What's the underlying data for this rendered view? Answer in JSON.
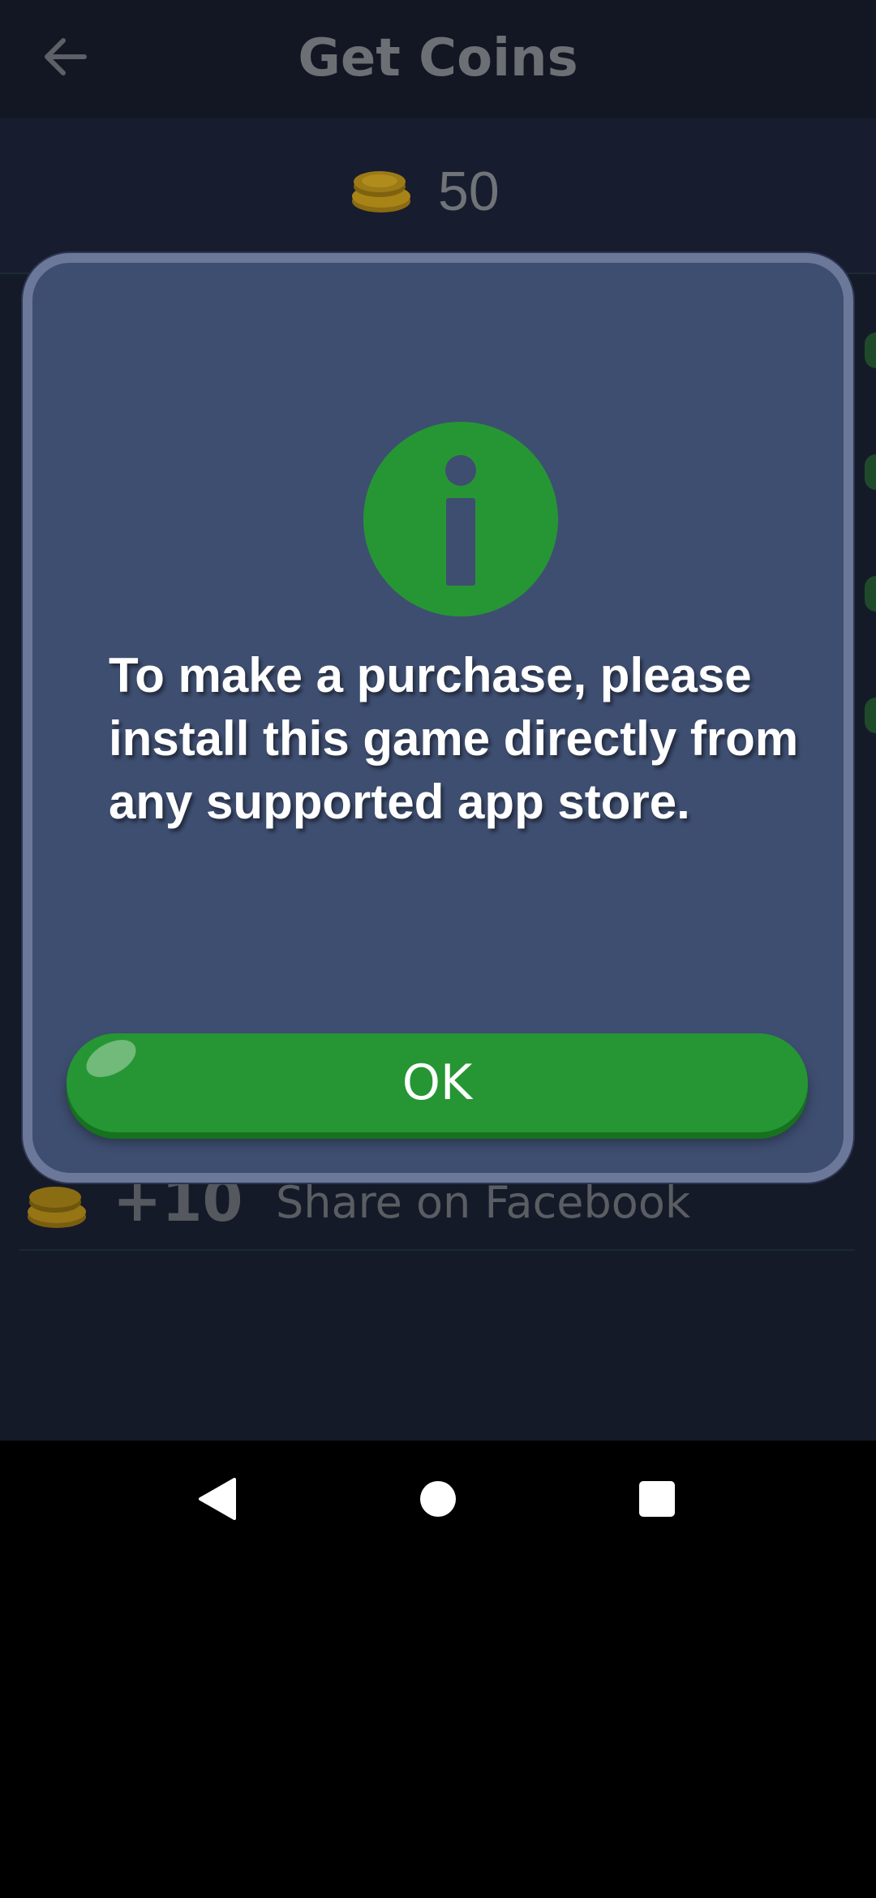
{
  "header": {
    "title": "Get Coins",
    "back_icon": "arrow-left-icon"
  },
  "balance": {
    "coin_icon": "coin-stack-icon",
    "value": "50"
  },
  "rewards": [
    {
      "coin_icon": "coin-stack-icon",
      "amount": "+10",
      "label": "Share on Facebook"
    }
  ],
  "dialog": {
    "icon": "info-icon",
    "message": "To make a purchase, please install this game directly from any supported app store.",
    "ok_label": "OK"
  },
  "nav": {
    "back_icon": "nav-back-icon",
    "home_icon": "nav-home-icon",
    "recents_icon": "nav-recents-icon"
  },
  "colors": {
    "screen_background": "#151a28",
    "dialog_background": "#3e4e70",
    "dialog_border": "#6c7899",
    "accent_green": "#269634",
    "text_white": "#ffffff"
  }
}
